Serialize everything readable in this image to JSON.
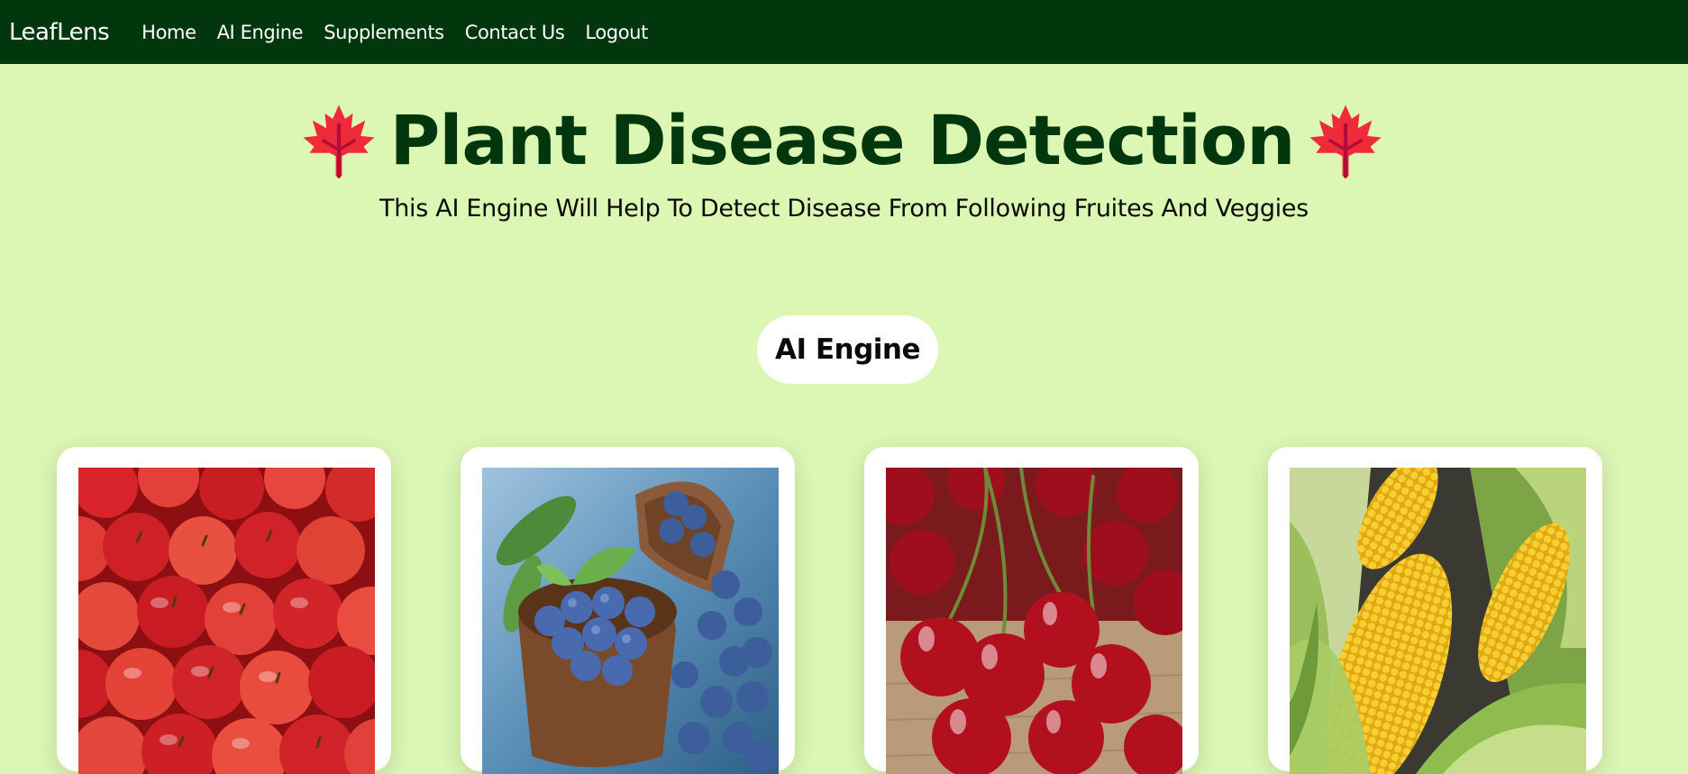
{
  "nav": {
    "brand": "LeafLens",
    "links": [
      "Home",
      "AI Engine",
      "Supplements",
      "Contact Us",
      "Logout"
    ]
  },
  "header": {
    "title": "Plant Disease Detection",
    "subtitle": "This AI Engine Will Help To Detect Disease From Following Fruites And Veggies",
    "icon": "maple-leaf-icon"
  },
  "engine_button": "AI Engine",
  "cards": [
    {
      "name": "apples",
      "image": "apples-image"
    },
    {
      "name": "blueberries",
      "image": "blueberries-image"
    },
    {
      "name": "cherries",
      "image": "cherries-image"
    },
    {
      "name": "corn",
      "image": "corn-image"
    }
  ],
  "colors": {
    "nav_bg": "#02370d",
    "page_bg": "#dcf6b4",
    "title": "#02370d",
    "leaf": "#ef2b3a"
  }
}
